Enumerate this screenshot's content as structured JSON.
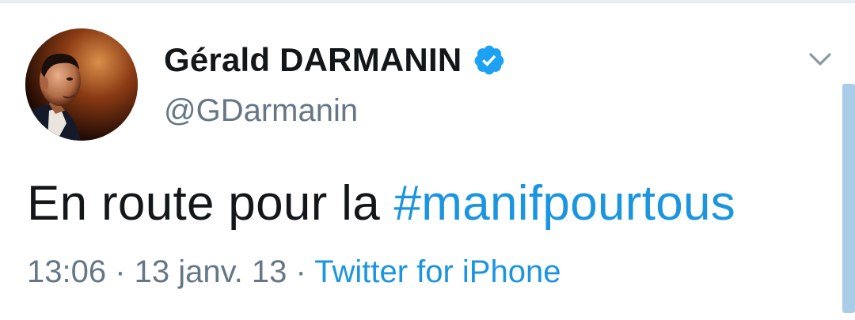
{
  "tweet": {
    "author": {
      "display_name": "Gérald DARMANIN",
      "handle": "@GDarmanin",
      "verified": true,
      "avatar": "profile-photo"
    },
    "text_prefix": "En route pour la ",
    "hashtag": "#manifpourtous",
    "time": "13:06",
    "separator": " · ",
    "date": "13 janv. 13",
    "source": "Twitter for iPhone"
  },
  "icons": {
    "verified": "verified-badge-icon",
    "more": "chevron-down-icon"
  },
  "colors": {
    "link": "#1b95e0",
    "secondary_text": "#657786",
    "primary_text": "#14171a",
    "verified_badge": "#1da1f2"
  }
}
